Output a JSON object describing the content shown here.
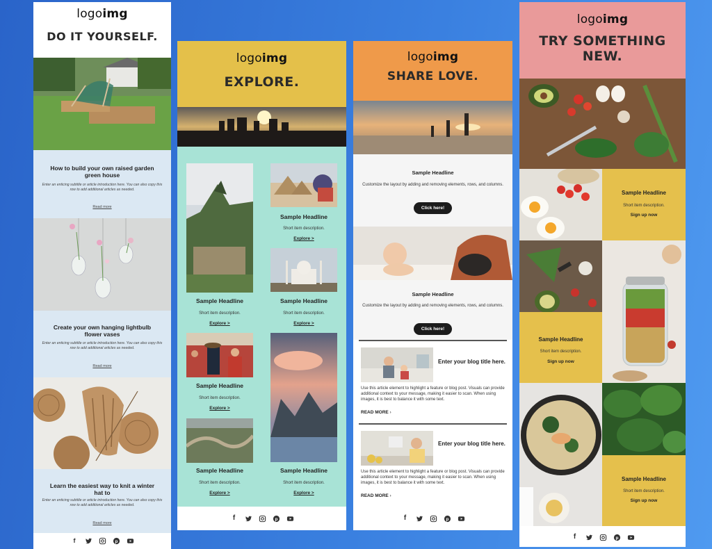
{
  "logo": {
    "prefix": "logo",
    "bold": "img"
  },
  "col1": {
    "title": "DO IT YOURSELF.",
    "articles": [
      {
        "title": "How to build your own raised garden green house",
        "intro": "Enter an enticing subtitle or article introduction here. You can also copy this row to add additional articles as needed.",
        "link": "Read more"
      },
      {
        "title": "Create your own hanging lightbulb flower vases",
        "intro": "Enter an enticing subtitle or article introduction here. You can also copy this row to add additional articles as needed.",
        "link": "Read more"
      },
      {
        "title": "Learn the easiest way to knit a winter hat to",
        "intro": "Enter an enticing subtitle or article introduction here. You can also copy this row to add additional articles as needed.",
        "link": "Read more"
      }
    ]
  },
  "col2": {
    "title": "EXPLORE.",
    "items": [
      {
        "headline": "Sample Headline",
        "desc": "Short item description.",
        "link": "Explore >"
      },
      {
        "headline": "Sample Headline",
        "desc": "Short item description.",
        "link": "Explore >"
      },
      {
        "headline": "Sample Headline",
        "desc": "Short item description.",
        "link": "Explore >"
      },
      {
        "headline": "Sample Headline",
        "desc": "Short item description.",
        "link": "Explore >"
      },
      {
        "headline": "Sample Headline",
        "desc": "Short item description.",
        "link": "Explore >"
      },
      {
        "headline": "Sample Headline",
        "desc": "Short item description.",
        "link": "Explore >"
      }
    ]
  },
  "col3": {
    "title": "SHARE LOVE.",
    "blocks": [
      {
        "headline": "Sample Headline",
        "body": "Customize the layout by adding and removing elements, rows, and columns.",
        "button": "Click here!"
      },
      {
        "headline": "Sample Headline",
        "body": "Customize the layout by adding and removing elements, rows, and columns.",
        "button": "Click here!"
      }
    ],
    "posts": [
      {
        "title": "Enter your blog title here.",
        "body": "Use this article element to highlight a feature or blog post. Visuals can provide additional context to your message, making it easier to scan. When using images, it is best to balance it with some text.",
        "link": "READ MORE"
      },
      {
        "title": "Enter your blog title here.",
        "body": "Use this article element to highlight a feature or blog post. Visuals can provide additional context to your message, making it easier to scan. When using images, it is best to balance it with some text.",
        "link": "READ MORE"
      }
    ]
  },
  "col4": {
    "title_line1": "TRY SOMETHING",
    "title_line2": "NEW.",
    "cards": [
      {
        "headline": "Sample Headline",
        "desc": "Short item description.",
        "link": "Sign up now"
      },
      {
        "headline": "Sample Headline",
        "desc": "Short item description.",
        "link": "Sign up now"
      },
      {
        "headline": "Sample Headline",
        "desc": "Short item description.",
        "link": "Sign up now"
      }
    ]
  },
  "colors": {
    "col2_header": "#e4c04a",
    "col2_body": "#a8e3d6",
    "col3_header": "#ef9a4a",
    "col4_header": "#e99a9a",
    "col4_card": "#e5c04c",
    "col1_panel": "#dbe8f3"
  },
  "social_icons": [
    "facebook-icon",
    "twitter-icon",
    "instagram-icon",
    "pinterest-icon",
    "youtube-icon"
  ]
}
